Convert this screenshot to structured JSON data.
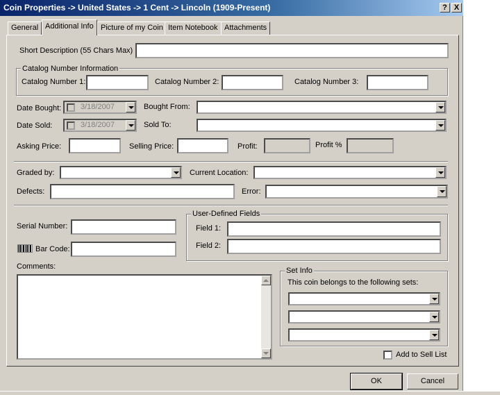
{
  "window": {
    "title": "Coin Properties -> United States -> 1 Cent -> Lincoln (1909-Present)",
    "help_btn": "?",
    "close_btn": "X"
  },
  "tabs": [
    {
      "label": "General"
    },
    {
      "label": "Additional Info",
      "active": true
    },
    {
      "label": "Picture of my Coin"
    },
    {
      "label": "Item Notebook"
    },
    {
      "label": "Attachments"
    }
  ],
  "form": {
    "short_desc_label": "Short Description (55 Chars Max)",
    "short_desc_value": "",
    "catalog_group_title": "Catalog Number Information",
    "catalog1_label": "Catalog Number 1:",
    "catalog2_label": "Catalog Number 2:",
    "catalog3_label": "Catalog Number 3:",
    "date_bought_label": "Date Bought:",
    "date_bought_value": "3/18/2007",
    "bought_from_label": "Bought From:",
    "date_sold_label": "Date Sold:",
    "date_sold_value": "3/18/2007",
    "sold_to_label": "Sold To:",
    "asking_price_label": "Asking Price:",
    "selling_price_label": "Selling Price:",
    "profit_label": "Profit:",
    "profit_pct_label": "Profit %",
    "graded_by_label": "Graded by:",
    "current_location_label": "Current Location:",
    "defects_label": "Defects:",
    "error_label": "Error:",
    "serial_number_label": "Serial Number:",
    "bar_code_label": "Bar Code:",
    "user_fields_title": "User-Defined Fields",
    "field1_label": "Field 1:",
    "field2_label": "Field 2:",
    "comments_label": "Comments:",
    "set_info_title": "Set Info",
    "set_info_desc": "This coin belongs to the following sets:",
    "add_to_sell_list_label": "Add to Sell List"
  },
  "buttons": {
    "ok": "OK",
    "cancel": "Cancel"
  },
  "colors": {
    "dialog_bg": "#d4d0c8",
    "titlebar_start": "#0a246a",
    "titlebar_end": "#a6caf0"
  }
}
